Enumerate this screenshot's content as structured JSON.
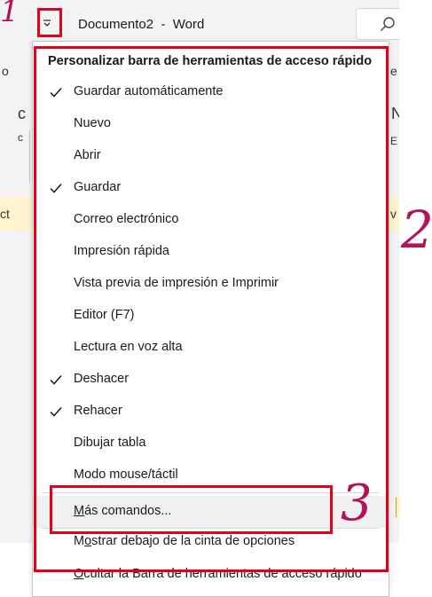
{
  "window": {
    "title": "Documento2  -  Word",
    "qat_icon": "chevron-down-with-line-icon",
    "search_icon": "search-icon"
  },
  "ribbon_fragments": {
    "left": [
      "o",
      "c",
      "c",
      "ct"
    ],
    "right": [
      "e",
      "N",
      "E",
      "v"
    ]
  },
  "menu": {
    "header": "Personalizar barra de herramientas de acceso rápido",
    "items": [
      {
        "label": "Guardar automáticamente",
        "checked": true
      },
      {
        "label": "Nuevo",
        "checked": false
      },
      {
        "label": "Abrir",
        "checked": false
      },
      {
        "label": "Guardar",
        "checked": true
      },
      {
        "label": "Correo electrónico",
        "checked": false
      },
      {
        "label": "Impresión rápida",
        "checked": false
      },
      {
        "label": "Vista previa de impresión e Imprimir",
        "checked": false
      },
      {
        "label": "Editor (F7)",
        "checked": false
      },
      {
        "label": "Lectura en voz alta",
        "checked": false
      },
      {
        "label": "Deshacer",
        "checked": true
      },
      {
        "label": "Rehacer",
        "checked": true
      },
      {
        "label": "Dibujar tabla",
        "checked": false
      },
      {
        "label": "Modo mouse/táctil",
        "checked": false
      }
    ],
    "more_commands": {
      "accel": "M",
      "rest": "ás comandos..."
    },
    "show_below": {
      "pre": "M",
      "accel": "o",
      "rest": "strar debajo de la cinta de opciones"
    },
    "hide_qat": {
      "accel": "O",
      "rest": "cultar la Barra de herramientas de acceso rápido"
    }
  },
  "annotations": {
    "labels": [
      "1",
      "2",
      "3"
    ],
    "box_color": "#e0001a",
    "number_color": "#b0155a"
  }
}
